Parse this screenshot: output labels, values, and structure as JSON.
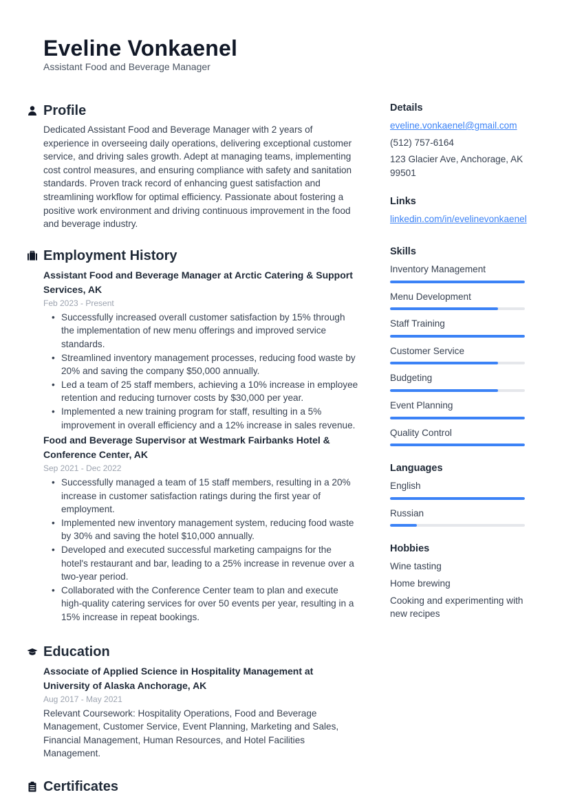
{
  "header": {
    "name": "Eveline Vonkaenel",
    "title": "Assistant Food and Beverage Manager"
  },
  "profile": {
    "title": "Profile",
    "icon": "user-icon",
    "text": "Dedicated Assistant Food and Beverage Manager with 2 years of experience in overseeing daily operations, delivering exceptional customer service, and driving sales growth. Adept at managing teams, implementing cost control measures, and ensuring compliance with safety and sanitation standards. Proven track record of enhancing guest satisfaction and streamlining workflow for optimal efficiency. Passionate about fostering a positive work environment and driving continuous improvement in the food and beverage industry."
  },
  "employment": {
    "title": "Employment History",
    "icon": "briefcase-icon",
    "jobs": [
      {
        "heading": "Assistant Food and Beverage Manager at Arctic Catering & Support Services, AK",
        "dates": "Feb 2023 - Present",
        "bullets": [
          "Successfully increased overall customer satisfaction by 15% through the implementation of new menu offerings and improved service standards.",
          "Streamlined inventory management processes, reducing food waste by 20% and saving the company $50,000 annually.",
          "Led a team of 25 staff members, achieving a 10% increase in employee retention and reducing turnover costs by $30,000 per year.",
          "Implemented a new training program for staff, resulting in a 5% improvement in overall efficiency and a 12% increase in sales revenue."
        ]
      },
      {
        "heading": "Food and Beverage Supervisor at Westmark Fairbanks Hotel & Conference Center, AK",
        "dates": "Sep 2021 - Dec 2022",
        "bullets": [
          "Successfully managed a team of 15 staff members, resulting in a 20% increase in customer satisfaction ratings during the first year of employment.",
          "Implemented new inventory management system, reducing food waste by 30% and saving the hotel $10,000 annually.",
          "Developed and executed successful marketing campaigns for the hotel's restaurant and bar, leading to a 25% increase in revenue over a two-year period.",
          "Collaborated with the Conference Center team to plan and execute high-quality catering services for over 50 events per year, resulting in a 15% increase in repeat bookings."
        ]
      }
    ]
  },
  "education": {
    "title": "Education",
    "icon": "graduation-cap-icon",
    "entries": [
      {
        "heading": "Associate of Applied Science in Hospitality Management at University of Alaska Anchorage, AK",
        "dates": "Aug 2017 - May 2021",
        "text": "Relevant Coursework: Hospitality Operations, Food and Beverage Management, Customer Service, Event Planning, Marketing and Sales, Financial Management, Human Resources, and Hotel Facilities Management."
      }
    ]
  },
  "certificates": {
    "title": "Certificates",
    "icon": "clipboard-icon"
  },
  "details": {
    "title": "Details",
    "email": "eveline.vonkaenel@gmail.com",
    "phone": "(512) 757-6164",
    "address": "123 Glacier Ave, Anchorage, AK 99501"
  },
  "links": {
    "title": "Links",
    "items": [
      "linkedin.com/in/evelinevonkaenel"
    ]
  },
  "skills": {
    "title": "Skills",
    "items": [
      {
        "label": "Inventory Management",
        "level": 1.0
      },
      {
        "label": "Menu Development",
        "level": 0.8
      },
      {
        "label": "Staff Training",
        "level": 1.0
      },
      {
        "label": "Customer Service",
        "level": 0.8
      },
      {
        "label": "Budgeting",
        "level": 0.8
      },
      {
        "label": "Event Planning",
        "level": 1.0
      },
      {
        "label": "Quality Control",
        "level": 1.0
      }
    ]
  },
  "languages": {
    "title": "Languages",
    "items": [
      {
        "label": "English",
        "level": 1.0
      },
      {
        "label": "Russian",
        "level": 0.2
      }
    ]
  },
  "hobbies": {
    "title": "Hobbies",
    "items": [
      "Wine tasting",
      "Home brewing",
      "Cooking and experimenting with new recipes"
    ]
  },
  "colors": {
    "accent": "#3b82f6",
    "track": "#e5e7eb",
    "heading": "#1f2937",
    "muted": "#9ca3af"
  }
}
